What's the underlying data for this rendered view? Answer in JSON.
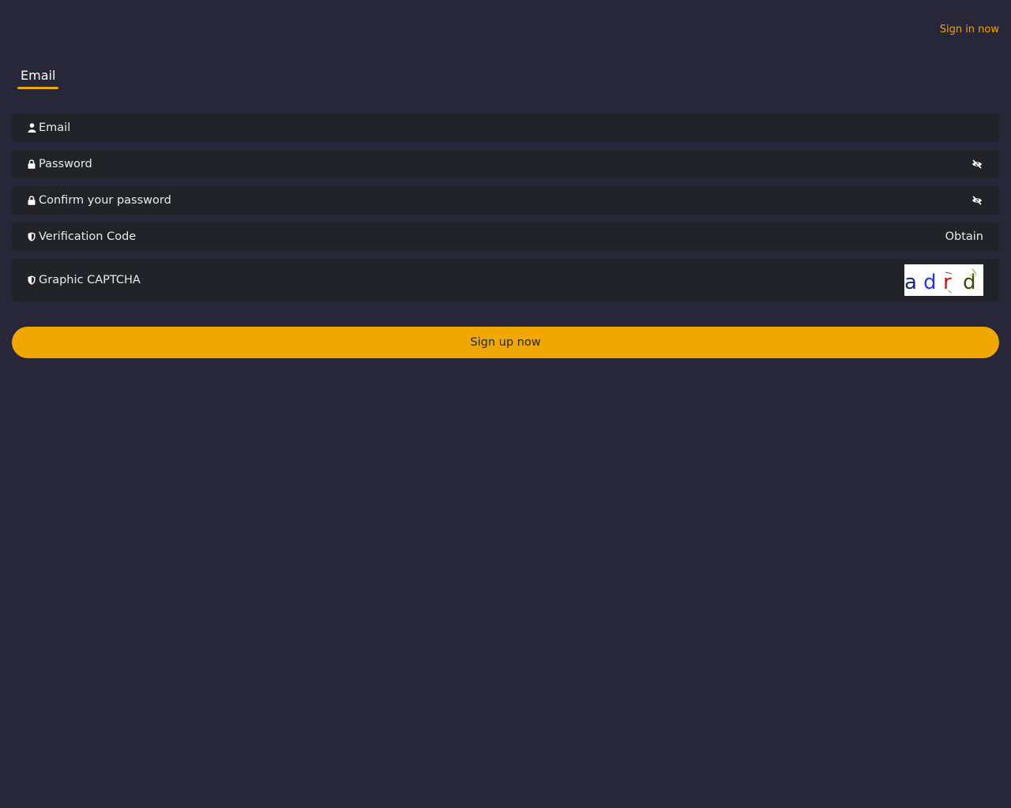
{
  "header": {
    "signin_link": "Sign in now"
  },
  "tabs": [
    {
      "label": "Email",
      "active": true
    }
  ],
  "form": {
    "email_placeholder": "Email",
    "password_placeholder": "Password",
    "confirm_password_placeholder": "Confirm your password",
    "verification_placeholder": "Verification Code",
    "obtain_label": "Obtain",
    "captcha_placeholder": "Graphic CAPTCHA",
    "captcha_text": "adrd"
  },
  "submit": {
    "label": "Sign up now"
  },
  "colors": {
    "accent": "#f0a800",
    "background": "#282739",
    "field": "#222328"
  },
  "icons": {
    "email": "user-icon",
    "password": "lock-icon",
    "confirm": "lock-icon",
    "verification": "shield-icon",
    "captcha": "shield-icon",
    "toggle": "eye-slash-icon"
  }
}
